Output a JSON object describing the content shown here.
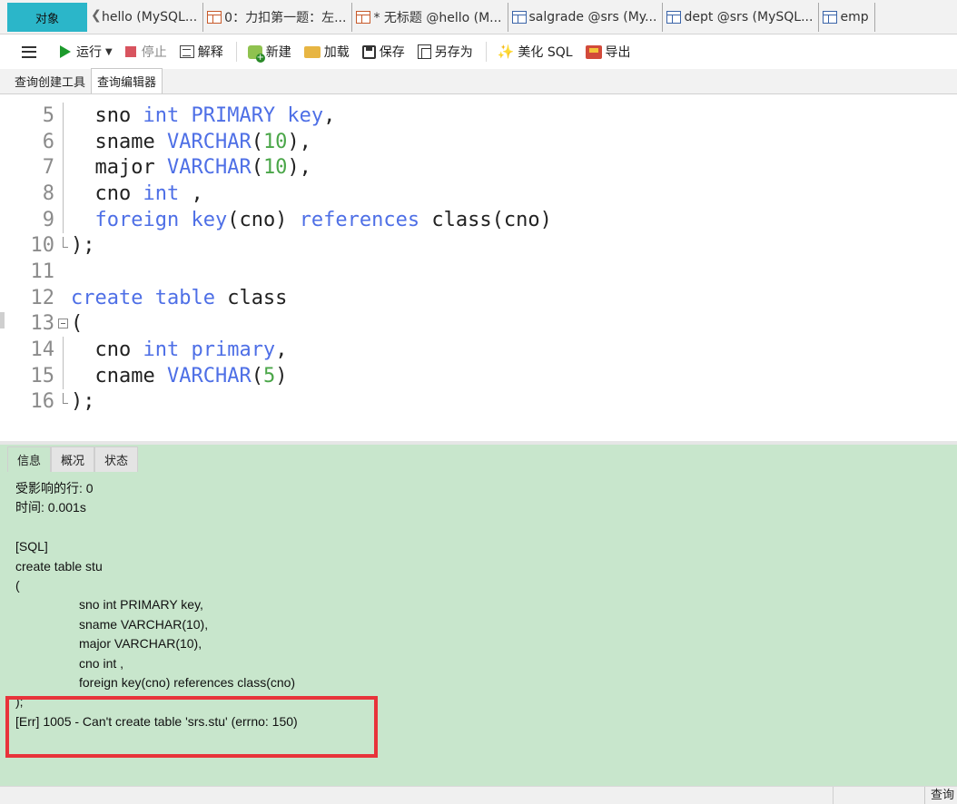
{
  "tabbar": {
    "objects_tab": "对象",
    "tabs": [
      {
        "label": "hello (MySQL...",
        "icon": "none"
      },
      {
        "label": "0：力扣第一题：左...",
        "icon": "query-icon"
      },
      {
        "label": "* 无标题 @hello (M...",
        "icon": "query-icon"
      },
      {
        "label": "salgrade @srs (My...",
        "icon": "table-icon"
      },
      {
        "label": "dept @srs (MySQL...",
        "icon": "table-icon"
      },
      {
        "label": "emp",
        "icon": "table-icon"
      }
    ]
  },
  "toolbar": {
    "run": "运行",
    "stop": "停止",
    "explain": "解释",
    "new": "新建",
    "load": "加载",
    "save": "保存",
    "save_as": "另存为",
    "beautify": "美化 SQL",
    "export": "导出"
  },
  "subtabs": {
    "query_builder": "查询创建工具",
    "query_editor": "查询编辑器"
  },
  "editor": {
    "lines": [
      {
        "n": "5",
        "fold": "line",
        "tokens": [
          [
            "p",
            "  sno "
          ],
          [
            "k",
            "int PRIMARY key"
          ],
          [
            "p",
            ","
          ]
        ]
      },
      {
        "n": "6",
        "fold": "line",
        "tokens": [
          [
            "p",
            "  sname "
          ],
          [
            "k",
            "VARCHAR"
          ],
          [
            "p",
            "("
          ],
          [
            "n",
            "10"
          ],
          [
            "p",
            "),"
          ]
        ]
      },
      {
        "n": "7",
        "fold": "line",
        "tokens": [
          [
            "p",
            "  major "
          ],
          [
            "k",
            "VARCHAR"
          ],
          [
            "p",
            "("
          ],
          [
            "n",
            "10"
          ],
          [
            "p",
            "),"
          ]
        ]
      },
      {
        "n": "8",
        "fold": "line",
        "tokens": [
          [
            "p",
            "  cno "
          ],
          [
            "k",
            "int"
          ],
          [
            "p",
            " ,"
          ]
        ]
      },
      {
        "n": "9",
        "fold": "line",
        "tokens": [
          [
            "p",
            "  "
          ],
          [
            "k",
            "foreign key"
          ],
          [
            "p",
            "(cno) "
          ],
          [
            "k",
            "references"
          ],
          [
            "p",
            " class(cno)"
          ]
        ]
      },
      {
        "n": "10",
        "fold": "end",
        "tokens": [
          [
            "p",
            ");"
          ]
        ]
      },
      {
        "n": "11",
        "fold": "none",
        "tokens": []
      },
      {
        "n": "12",
        "fold": "none",
        "tokens": [
          [
            "k",
            "create table"
          ],
          [
            "p",
            " class"
          ]
        ]
      },
      {
        "n": "13",
        "fold": "open",
        "tokens": [
          [
            "p",
            "("
          ]
        ]
      },
      {
        "n": "14",
        "fold": "line",
        "tokens": [
          [
            "p",
            "  cno "
          ],
          [
            "k",
            "int primary"
          ],
          [
            "p",
            ","
          ]
        ]
      },
      {
        "n": "15",
        "fold": "line",
        "tokens": [
          [
            "p",
            "  cname "
          ],
          [
            "k",
            "VARCHAR"
          ],
          [
            "p",
            "("
          ],
          [
            "n",
            "5"
          ],
          [
            "p",
            ")"
          ]
        ]
      },
      {
        "n": "16",
        "fold": "end",
        "tokens": [
          [
            "p",
            ");"
          ]
        ]
      }
    ]
  },
  "panel": {
    "tabs": [
      "信息",
      "概况",
      "状态"
    ],
    "active_tab": "信息",
    "output": [
      {
        "text": "受影响的行: 0",
        "indent": false
      },
      {
        "text": "时间: 0.001s",
        "indent": false
      },
      {
        "text": "",
        "indent": false
      },
      {
        "text": "[SQL]",
        "indent": false
      },
      {
        "text": "create table stu",
        "indent": false
      },
      {
        "text": "(",
        "indent": false
      },
      {
        "text": "sno int PRIMARY key,",
        "indent": true
      },
      {
        "text": "sname VARCHAR(10),",
        "indent": true
      },
      {
        "text": "major VARCHAR(10),",
        "indent": true
      },
      {
        "text": "cno int ,",
        "indent": true
      },
      {
        "text": "foreign key(cno) references class(cno)",
        "indent": true
      },
      {
        "text": ");",
        "indent": false
      },
      {
        "text": "[Err] 1005 - Can't create table 'srs.stu' (errno: 150)",
        "indent": false
      }
    ]
  },
  "statusbar": {
    "right_label": "查询"
  },
  "colors": {
    "keyword": "#4e6fe6",
    "number": "#4aa648",
    "panel_bg": "#c8e6cc",
    "objects_tab": "#2bb6c9",
    "highlight": "#e8333a"
  }
}
